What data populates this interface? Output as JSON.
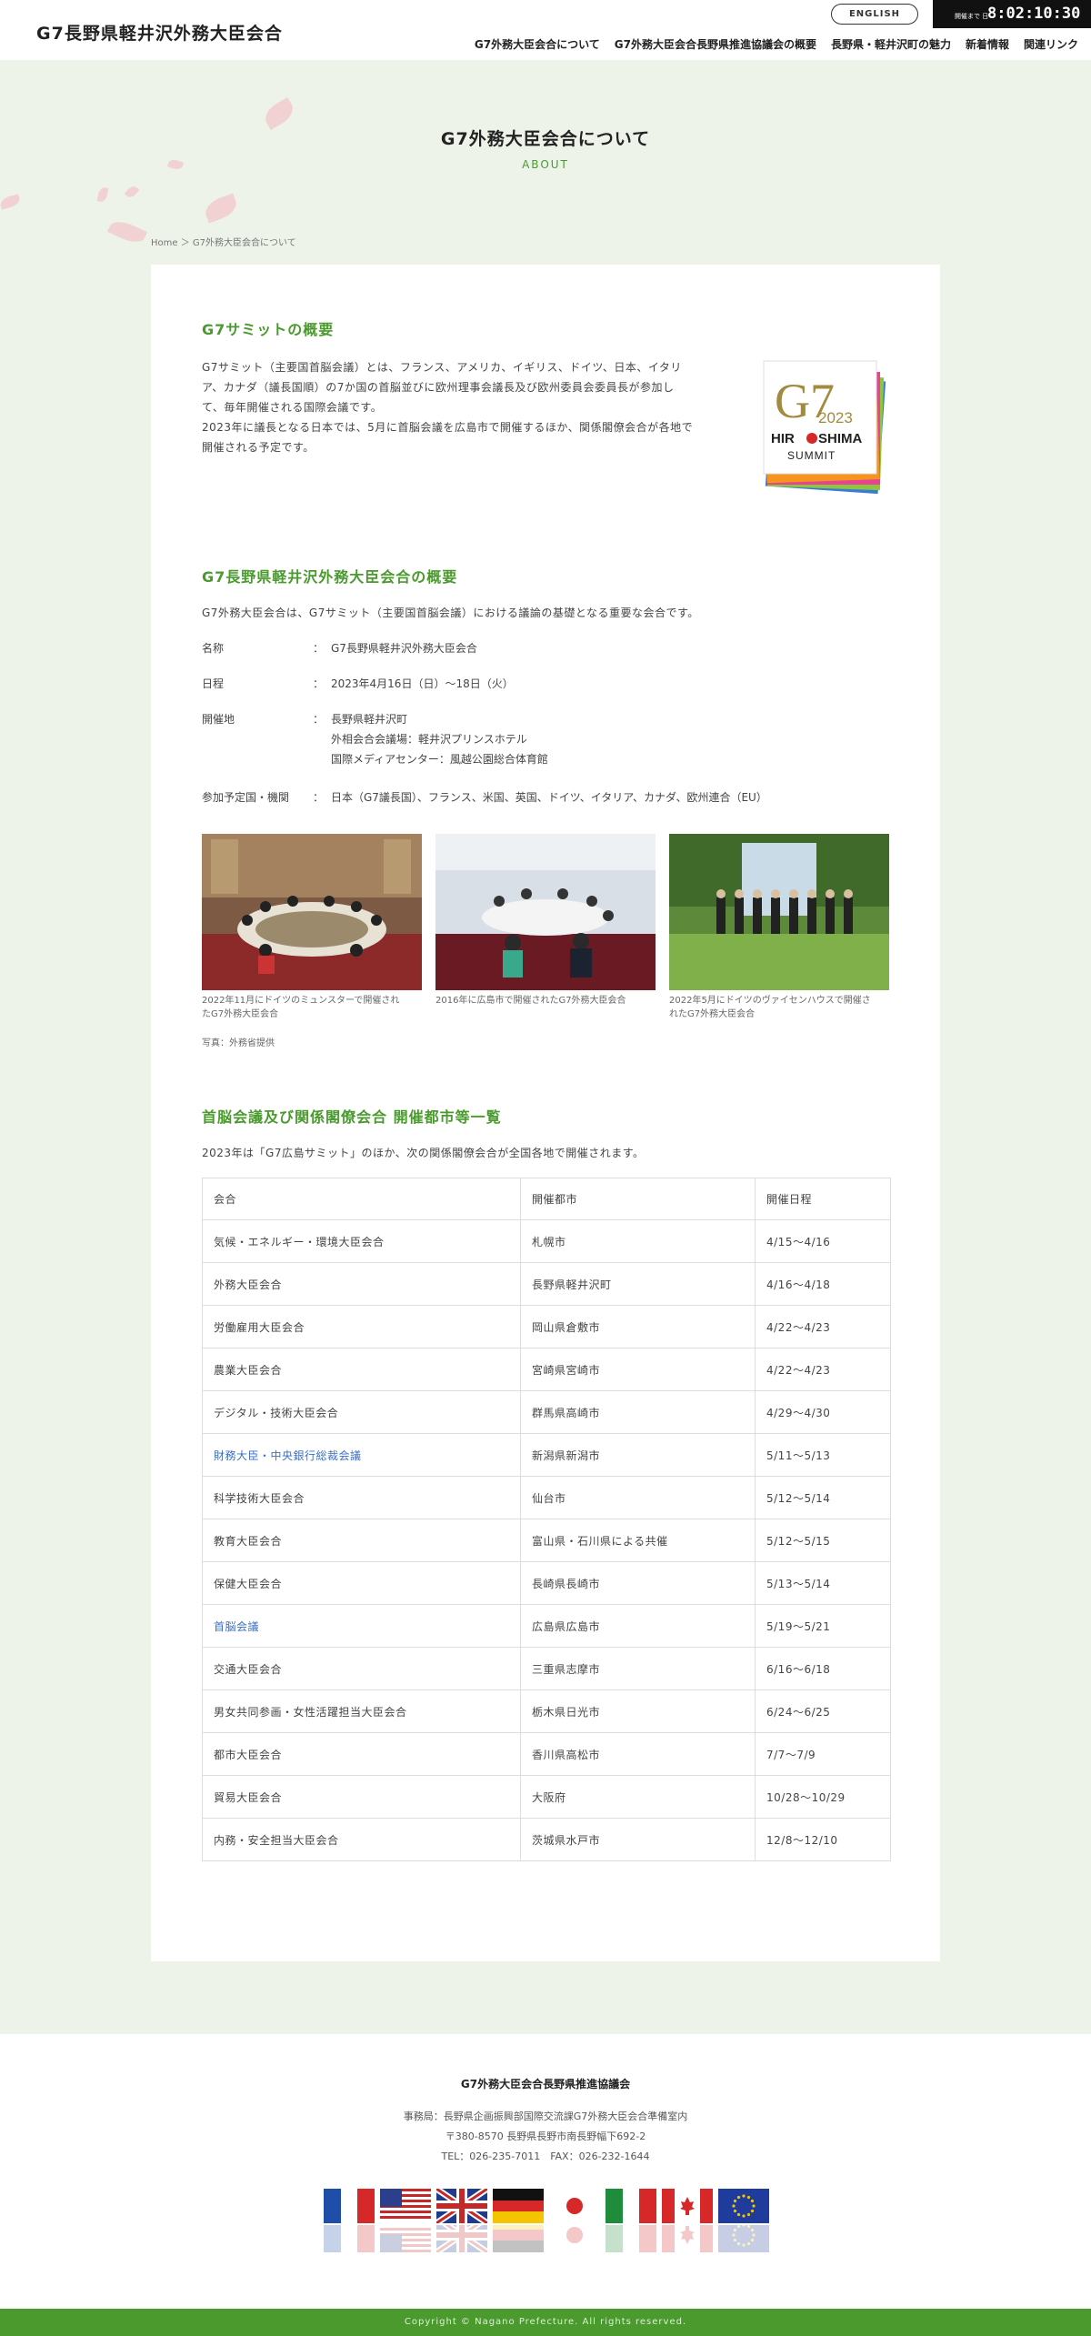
{
  "header": {
    "site_title": "G7長野県軽井沢外務大臣会合",
    "english_label": "ENGLISH",
    "clock_caption": "開催まで 日",
    "clock_value": "8:02:10:30",
    "nav": [
      "G7外務大臣会合について",
      "G7外務大臣会合長野県推進協議会の概要",
      "長野県・軽井沢町の魅力",
      "新着情報",
      "関連リンク"
    ]
  },
  "hero": {
    "title": "G7外務大臣会合について",
    "subtitle": "ABOUT",
    "breadcrumb": "Home ＞ G7外務大臣会合について"
  },
  "summit": {
    "heading": "G7サミットの概要",
    "lines": [
      "G7サミット（主要国首脳会議）とは、フランス、アメリカ、イギリス、ドイツ、日本、イタリ",
      "ア、カナダ（議長国順）の7か国の首脳並びに欧州理事会議長及び欧州委員会委員長が参加し",
      "て、毎年開催される国際会議です。",
      "2023年に議長となる日本では、5月に首脳会議を広島市で開催するほか、関係閣僚会合が各地で",
      "開催される予定です。"
    ],
    "logo": {
      "mark": "G7",
      "year": "2023",
      "city_a": "HIR",
      "city_b": "SHIMA",
      "summit": "SUMMIT"
    }
  },
  "meeting": {
    "heading": "G7長野県軽井沢外務大臣会合の概要",
    "intro": "G7外務大臣会合は、G7サミット（主要国首脳会議）における議論の基礎となる重要な会合です。",
    "name_label": "名称",
    "name_value": "G7長野県軽井沢外務大臣会合",
    "date_label": "日程",
    "date_value": "2023年4月16日（日）〜18日（火）",
    "venue_label": "開催地",
    "venue_lines": [
      "長野県軽井沢町",
      "外相会合会議場：軽井沢プリンスホテル",
      "国際メディアセンター：風越公園総合体育館"
    ],
    "members_label": "参加予定国・機関",
    "members_value": "日本（G7議長国）、フランス、米国、英国、ドイツ、イタリア、カナダ、欧州連合（EU）",
    "colon": "：",
    "photos": [
      {
        "caption_lines": [
          "2022年11月にドイツのミュンスターで開催され",
          "たG7外務大臣会合"
        ]
      },
      {
        "caption_lines": [
          "2016年に広島市で開催されたG7外務大臣会合"
        ]
      },
      {
        "caption_lines": [
          "2022年5月にドイツのヴァイセンハウスで開催さ",
          "れたG7外務大臣会合"
        ]
      }
    ],
    "photo_credit": "写真：外務省提供"
  },
  "schedule": {
    "heading": "首脳会議及び関係閣僚会合 開催都市等一覧",
    "intro": "2023年は「G7広島サミット」のほか、次の関係閣僚会合が全国各地で開催されます。",
    "columns": [
      "会合",
      "開催都市",
      "開催日程"
    ],
    "rows": [
      [
        "気候・エネルギー・環境大臣会合",
        "札幌市",
        "4/15〜4/16"
      ],
      [
        "外務大臣会合",
        "長野県軽井沢町",
        "4/16〜4/18"
      ],
      [
        "労働雇用大臣会合",
        "岡山県倉敷市",
        "4/22〜4/23"
      ],
      [
        "農業大臣会合",
        "宮崎県宮崎市",
        "4/22〜4/23"
      ],
      [
        "デジタル・技術大臣会合",
        "群馬県高崎市",
        "4/29〜4/30"
      ],
      [
        "財務大臣・中央銀行総裁会議",
        "新潟県新潟市",
        "5/11〜5/13"
      ],
      [
        "科学技術大臣会合",
        "仙台市",
        "5/12〜5/14"
      ],
      [
        "教育大臣会合",
        "富山県・石川県による共催",
        "5/12〜5/15"
      ],
      [
        "保健大臣会合",
        "長崎県長崎市",
        "5/13〜5/14"
      ],
      [
        "首脳会議",
        "広島県広島市",
        "5/19〜5/21"
      ],
      [
        "交通大臣会合",
        "三重県志摩市",
        "6/16〜6/18"
      ],
      [
        "男女共同参画・女性活躍担当大臣会合",
        "栃木県日光市",
        "6/24〜6/25"
      ],
      [
        "都市大臣会合",
        "香川県高松市",
        "7/7〜7/9"
      ],
      [
        "貿易大臣会合",
        "大阪府",
        "10/28〜10/29"
      ],
      [
        "内務・安全担当大臣会合",
        "茨城県水戸市",
        "12/8〜12/10"
      ]
    ],
    "link_rows": [
      5,
      9
    ],
    "link_color": "#3a6fc4"
  },
  "footer": {
    "org": "G7外務大臣会合長野県推進協議会",
    "office": "事務局：長野県企画振興部国際交流課G7外務大臣会合準備室内",
    "address": "〒380-8570 長野県長野市南長野幅下692-2",
    "tel": "TEL：026-235-7011　FAX：026-232-1644",
    "flags": [
      "france-flag",
      "usa-flag",
      "uk-flag",
      "germany-flag",
      "japan-flag",
      "italy-flag",
      "canada-flag",
      "eu-flag"
    ],
    "copyright": "Copyright © Nagano Prefecture. All rights reserved."
  },
  "colors": {
    "accent": "#4a9a2e",
    "background": "#eef3ea",
    "link": "#3a6fc4"
  }
}
